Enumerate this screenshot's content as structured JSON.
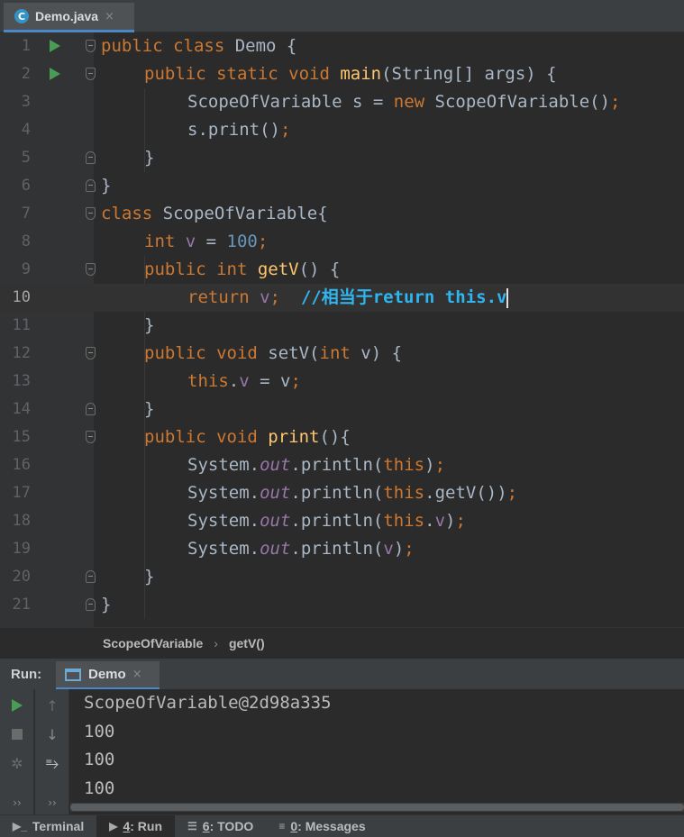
{
  "tab": {
    "icon": "C",
    "label": "Demo.java",
    "close": "×"
  },
  "editor": {
    "lines": [
      {
        "n": "1"
      },
      {
        "n": "2"
      },
      {
        "n": "3"
      },
      {
        "n": "4"
      },
      {
        "n": "5"
      },
      {
        "n": "6"
      },
      {
        "n": "7"
      },
      {
        "n": "8"
      },
      {
        "n": "9"
      },
      {
        "n": "10"
      },
      {
        "n": "11"
      },
      {
        "n": "12"
      },
      {
        "n": "13"
      },
      {
        "n": "14"
      },
      {
        "n": "15"
      },
      {
        "n": "16"
      },
      {
        "n": "17"
      },
      {
        "n": "18"
      },
      {
        "n": "19"
      },
      {
        "n": "20"
      },
      {
        "n": "21"
      }
    ],
    "current_line": "10",
    "tokens": {
      "l1": [
        "public class ",
        "Demo {"
      ],
      "l2": [
        "public static void ",
        "main",
        "(String[] args) {"
      ],
      "l3": [
        "ScopeOfVariable s = ",
        "new ",
        "ScopeOfVariable()",
        ";"
      ],
      "l4": [
        "s.print()",
        ";"
      ],
      "l5": [
        "}"
      ],
      "l6": [
        "}"
      ],
      "l7": [
        "class ",
        "ScopeOfVariable{"
      ],
      "l8": [
        "int ",
        "v",
        " = ",
        "100",
        ";"
      ],
      "l9": [
        "public int ",
        "getV",
        "() {"
      ],
      "l10": [
        "return ",
        "v",
        ";  ",
        "//相当于return this.v"
      ],
      "l11": [
        "}"
      ],
      "l12": [
        "public void ",
        "setV",
        "(",
        "int ",
        "v) {"
      ],
      "l13": [
        "this",
        ".",
        "v",
        " = v",
        ";"
      ],
      "l14": [
        "}"
      ],
      "l15": [
        "public void ",
        "print",
        "(){"
      ],
      "l16": [
        "System.",
        "out",
        ".println(",
        "this",
        ")",
        ";"
      ],
      "l17": [
        "System.",
        "out",
        ".println(",
        "this",
        ".getV())",
        ";"
      ],
      "l18": [
        "System.",
        "out",
        ".println(",
        "this",
        ".",
        "v",
        ")",
        ";"
      ],
      "l19": [
        "System.",
        "out",
        ".println(",
        "v",
        ")",
        ";"
      ],
      "l20": [
        "}"
      ],
      "l21": [
        "}"
      ]
    }
  },
  "breadcrumb": {
    "class_name": "ScopeOfVariable",
    "separator": "›",
    "method": "getV()"
  },
  "run_panel": {
    "label": "Run:",
    "tab_label": "Demo",
    "tab_close": "×",
    "output": [
      "ScopeOfVariable@2d98a335",
      "100",
      "100",
      "100"
    ],
    "toolbar_a": {
      "expand": "››"
    },
    "toolbar_b": {
      "up": "↑",
      "down": "↓",
      "expand": "››"
    }
  },
  "bottom_bar": [
    {
      "key": "",
      "label": "Terminal",
      "icon": "terminal-icon"
    },
    {
      "key": "4",
      "label": ": Run",
      "icon": "run-icon"
    },
    {
      "key": "6",
      "label": ": TODO",
      "icon": "todo-icon"
    },
    {
      "key": "0",
      "label": ": Messages",
      "icon": "messages-icon"
    }
  ],
  "colors": {
    "keyword": "#cc7832",
    "method": "#ffc66d",
    "field": "#9876aa",
    "number": "#6897bb",
    "comment": "#2fb5f0",
    "run_green": "#499c54",
    "accent": "#4a88c7"
  }
}
